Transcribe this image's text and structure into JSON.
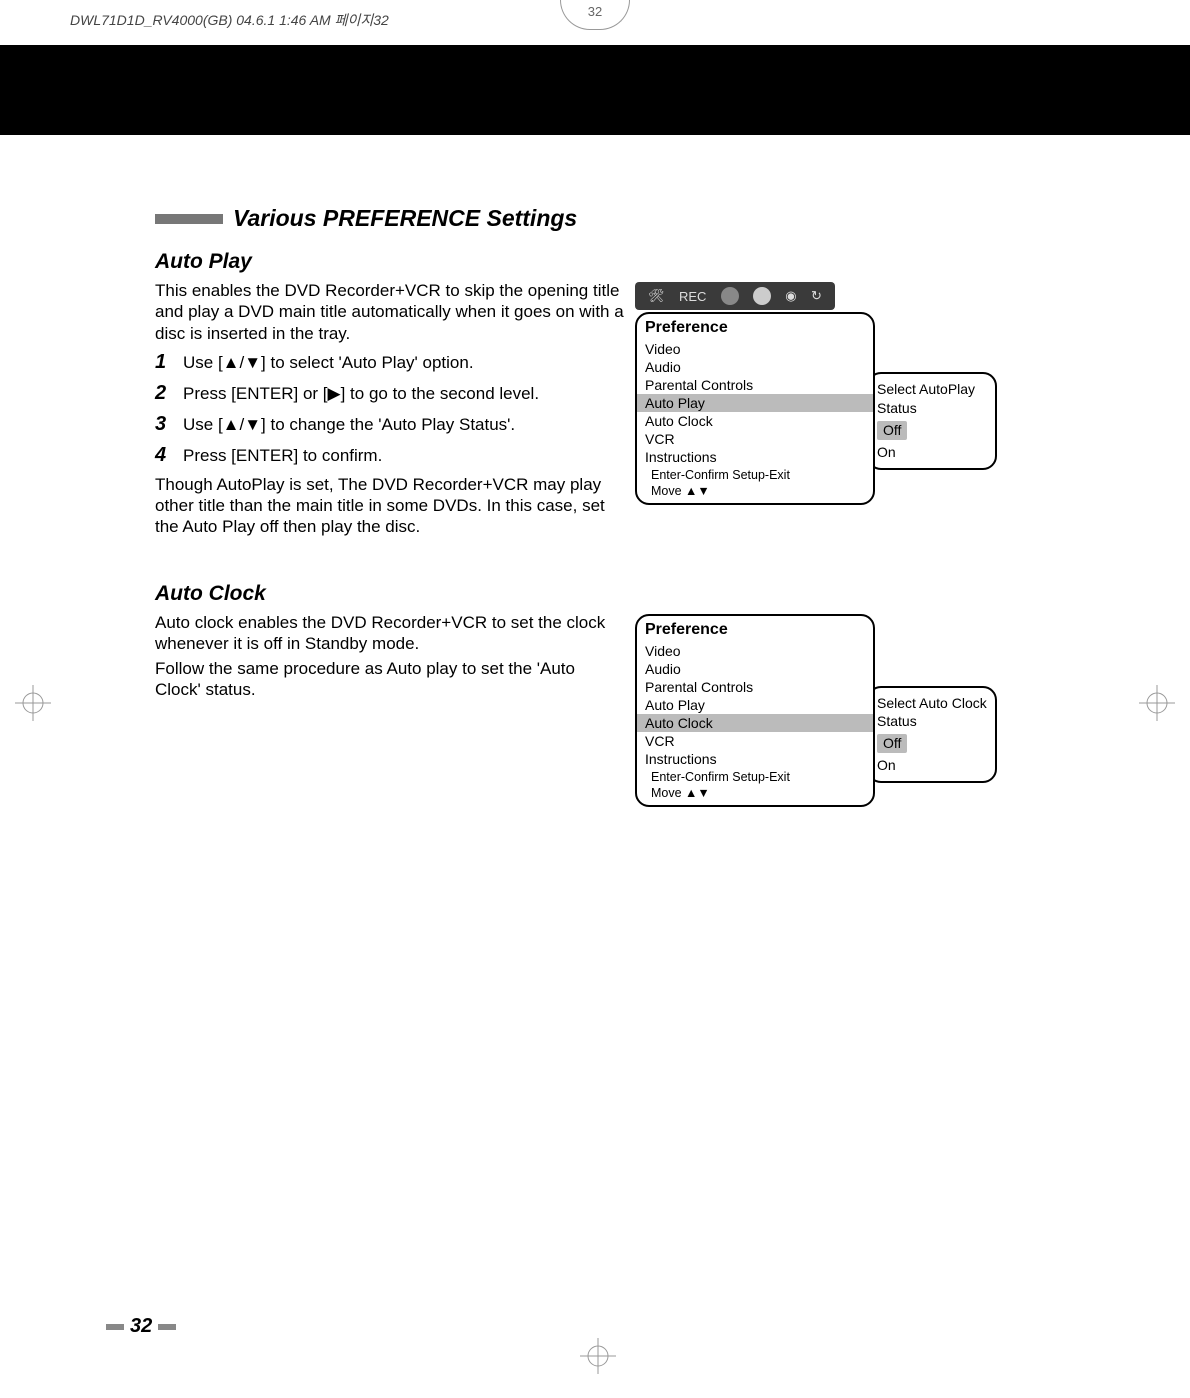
{
  "print_header": "DWL71D1D_RV4000(GB)  04.6.1 1:46 AM  페이지32",
  "crop_page": "32",
  "page_number": "32",
  "section_title": "Various PREFERENCE Settings",
  "auto_play": {
    "heading": "Auto Play",
    "intro": "This enables the DVD Recorder+VCR to skip the opening title and play a DVD main title automatically when it goes on with a disc is inserted in the tray.",
    "steps": [
      {
        "num": "1",
        "text": "Use [▲/▼] to select 'Auto Play' option."
      },
      {
        "num": "2",
        "text": "Press [ENTER] or [▶] to go to the second level."
      },
      {
        "num": "3",
        "text": "Use [▲/▼] to change the 'Auto Play Status'."
      },
      {
        "num": "4",
        "text": "Press [ENTER] to confirm."
      }
    ],
    "note": "Though AutoPlay is set, The DVD Recorder+VCR may play other title than the main title in some DVDs. In this case, set the Auto Play off then play the disc.",
    "menu": {
      "header": "Preference",
      "items": [
        "Video",
        "Audio",
        "Parental Controls",
        "Auto Play",
        "Auto Clock",
        "VCR",
        "Instructions"
      ],
      "highlight_index": 3,
      "hint1": "Enter-Confirm   Setup-Exit",
      "hint2": "Move ▲▼"
    },
    "side": {
      "title": "Select AutoPlay Status",
      "options": [
        "Off",
        "On"
      ],
      "selected_index": 0
    }
  },
  "auto_clock": {
    "heading": "Auto Clock",
    "para1": "Auto clock enables the DVD Recorder+VCR to set the clock whenever it is off in Standby mode.",
    "para2": "Follow the same procedure as Auto play to set the 'Auto Clock' status.",
    "menu": {
      "header": "Preference",
      "items": [
        "Video",
        "Audio",
        "Parental Controls",
        "Auto Play",
        "Auto Clock",
        "VCR",
        "Instructions"
      ],
      "highlight_index": 4,
      "hint1": "Enter-Confirm   Setup-Exit",
      "hint2": "Move ▲▼"
    },
    "side": {
      "title": "Select Auto Clock Status",
      "options": [
        "Off",
        "On"
      ],
      "selected_index": 0
    }
  },
  "icon_bar": {
    "rec_label": "REC"
  }
}
